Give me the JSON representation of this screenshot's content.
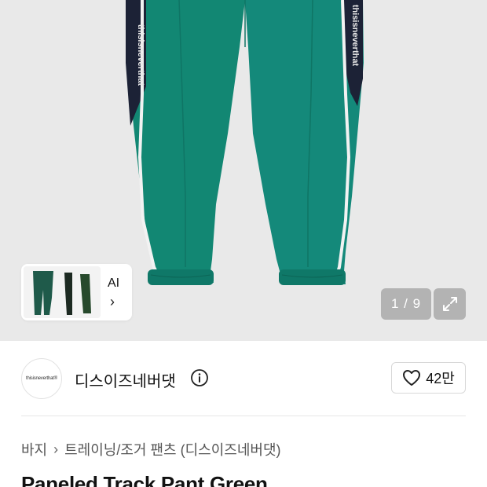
{
  "gallery": {
    "current_image": "1",
    "total_images": "9",
    "counter_text": "1 / 9",
    "expand_icon": "expand-arrows-icon",
    "ai_card": {
      "label": "AI",
      "arrow": "›",
      "arrow_icon": "chevron-right-icon"
    },
    "colors": {
      "pant_green": "#128773",
      "panel_navy": "#1c2236",
      "piping": "#f2f2f2",
      "background": "#e9e9e9"
    }
  },
  "brand": {
    "name": "디스이즈네버댓",
    "logo_text": "thisisneverthat®",
    "info_icon": "info-circle-icon",
    "like_icon": "heart-outline-icon",
    "like_count": "42만"
  },
  "breadcrumb": {
    "items": [
      "바지",
      "트레이닝/조거 팬츠 (디스이즈네버댓)"
    ],
    "separator": "›"
  },
  "product": {
    "title": "Paneled Track Pant Green"
  }
}
